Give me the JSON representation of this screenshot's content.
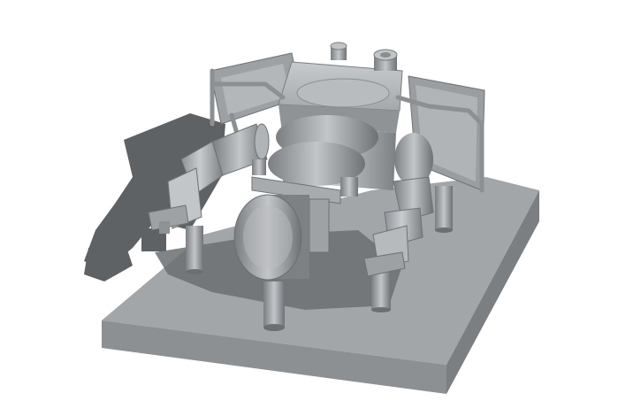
{
  "scene": {
    "subject": "3d-printed-robot-model",
    "background_color": "#ffffff",
    "model_color": "#a9adb0",
    "shadow_color": "#5e6163",
    "base_color": "#9ea1a4"
  }
}
